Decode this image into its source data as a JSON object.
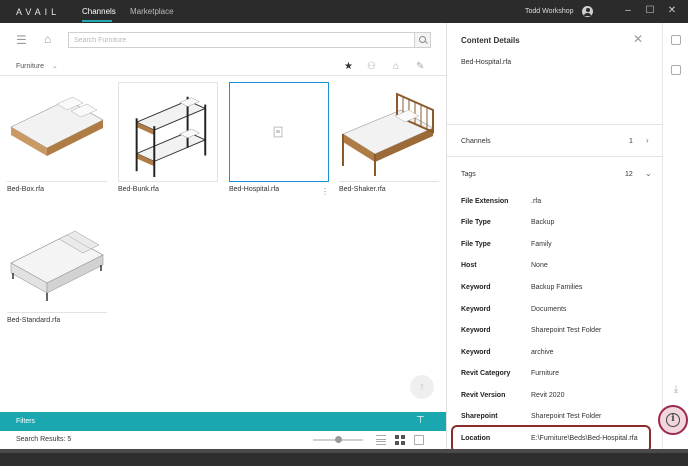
{
  "app": {
    "brand": "AVAIL",
    "tabs": [
      {
        "label": "Channels",
        "active": true
      },
      {
        "label": "Marketplace",
        "active": false
      }
    ],
    "user_name": "Todd Workshop",
    "accent_color": "#1aa7b0"
  },
  "toolbar": {
    "search_placeholder": "Search Furniture"
  },
  "breadcrumb": {
    "label": "Furniture"
  },
  "items": [
    {
      "label": "Bed-Box.rfa"
    },
    {
      "label": "Bed-Bunk.rfa"
    },
    {
      "label": "Bed-Hospital.rfa",
      "selected": true
    },
    {
      "label": "Bed-Shaker.rfa"
    },
    {
      "label": "Bed-Standard.rfa"
    }
  ],
  "filters": {
    "label": "Filters"
  },
  "status": {
    "results_text": "Search Results: 5"
  },
  "details": {
    "title": "Content Details",
    "file_name": "Bed-Hospital.rfa",
    "channels_label": "Channels",
    "channels_count": "1",
    "tags_label": "Tags",
    "tags_count": "12",
    "properties": [
      {
        "key": "File Extension",
        "value": ".rfa"
      },
      {
        "key": "File Type",
        "value": "Backup"
      },
      {
        "key": "File Type",
        "value": "Family"
      },
      {
        "key": "Host",
        "value": "None"
      },
      {
        "key": "Keyword",
        "value": "Backup Families"
      },
      {
        "key": "Keyword",
        "value": "Documents"
      },
      {
        "key": "Keyword",
        "value": "Sharepoint Test Folder"
      },
      {
        "key": "Keyword",
        "value": "archive"
      },
      {
        "key": "Revit Category",
        "value": "Furniture"
      },
      {
        "key": "Revit Version",
        "value": "Revit 2020"
      },
      {
        "key": "Sharepoint",
        "value": "Sharepoint Test Folder"
      },
      {
        "key": "Location",
        "value": "E:\\Furniture\\Beds\\Bed-Hospital.rfa"
      }
    ]
  }
}
